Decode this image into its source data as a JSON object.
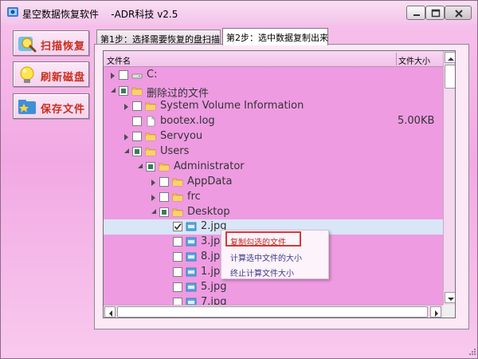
{
  "window": {
    "title": "星空数据恢复软件    -ADR科技 v2.5"
  },
  "sidebar": {
    "scan_label": "扫描恢复",
    "refresh_label": "刷新磁盘",
    "save_label": "保存文件"
  },
  "tabs": [
    {
      "label": "第1步：选择需要恢复的盘扫描",
      "active": false
    },
    {
      "label": "第2步：选中数据复制出来",
      "active": true
    }
  ],
  "tree": {
    "col_name": "文件名",
    "col_size": "文件大小",
    "rows": [
      {
        "name": "C:",
        "size": "",
        "expand": "collapsed",
        "check": "none",
        "icon": "drive-icon"
      },
      {
        "name": "删除过的文件",
        "size": "",
        "expand": "expanded",
        "check": "partial",
        "icon": "folder-icon"
      },
      {
        "name": "System Volume Information",
        "size": "",
        "expand": "collapsed",
        "check": "none",
        "icon": "folder-icon"
      },
      {
        "name": "bootex.log",
        "size": "5.00KB",
        "expand": "",
        "check": "none",
        "icon": "file-icon"
      },
      {
        "name": "Servyou",
        "size": "",
        "expand": "collapsed",
        "check": "none",
        "icon": "folder-icon"
      },
      {
        "name": "Users",
        "size": "",
        "expand": "expanded",
        "check": "partial",
        "icon": "folder-icon"
      },
      {
        "name": "Administrator",
        "size": "",
        "expand": "expanded",
        "check": "partial",
        "icon": "folder-icon"
      },
      {
        "name": "AppData",
        "size": "",
        "expand": "collapsed",
        "check": "none",
        "icon": "folder-icon"
      },
      {
        "name": "frc",
        "size": "",
        "expand": "collapsed",
        "check": "none",
        "icon": "folder-icon"
      },
      {
        "name": "Desktop",
        "size": "",
        "expand": "expanded",
        "check": "partial",
        "icon": "folder-icon"
      },
      {
        "name": "2.jpg",
        "size": "",
        "expand": "",
        "check": "checked",
        "icon": "image-file-icon"
      },
      {
        "name": "3.jpg",
        "size": "",
        "expand": "",
        "check": "none",
        "icon": "image-file-icon"
      },
      {
        "name": "8.jpg",
        "size": "",
        "expand": "",
        "check": "none",
        "icon": "image-file-icon"
      },
      {
        "name": "1.jpg",
        "size": "",
        "expand": "",
        "check": "none",
        "icon": "image-file-icon"
      },
      {
        "name": "5.jpg",
        "size": "",
        "expand": "",
        "check": "none",
        "icon": "image-file-icon"
      },
      {
        "name": "7.jpg",
        "size": "",
        "expand": "",
        "check": "none",
        "icon": "image-file-icon"
      }
    ]
  },
  "context_menu": {
    "items": [
      "复制勾选的文件",
      "计算选中文件的大小",
      "终止计算文件大小"
    ]
  },
  "colors": {
    "accent_red": "#c82e1c",
    "background_pink": "#f2a9e3",
    "tree_background": "#ee9be2"
  }
}
